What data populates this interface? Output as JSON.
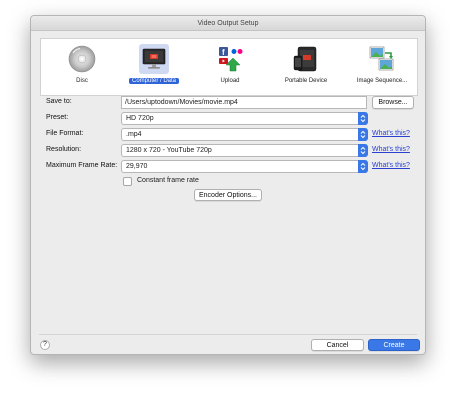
{
  "window": {
    "title": "Video Output Setup"
  },
  "toolbar": {
    "items": [
      {
        "label": "Disc",
        "icon": "disc-icon"
      },
      {
        "label": "Computer / Data",
        "icon": "computer-monitor-icon",
        "selected": true
      },
      {
        "label": "Upload",
        "icon": "upload-icon"
      },
      {
        "label": "Portable Device",
        "icon": "portable-device-icon"
      },
      {
        "label": "Image Sequence...",
        "icon": "image-sequence-icon"
      }
    ]
  },
  "form": {
    "save_to_label": "Save to:",
    "save_to_value": "/Users/uptodown/Movies/movie.mp4",
    "browse_label": "Browse...",
    "preset_label": "Preset:",
    "preset_value": "HD 720p",
    "file_format_label": "File Format:",
    "file_format_value": ".mp4",
    "resolution_label": "Resolution:",
    "resolution_value": "1280 x 720 - YouTube 720p",
    "frame_rate_label": "Maximum Frame Rate:",
    "frame_rate_value": "29,970",
    "whats_this": "What's this?",
    "constant_frame_rate_label": "Constant frame rate",
    "constant_frame_rate_checked": false,
    "encoder_options_label": "Encoder Options..."
  },
  "footer": {
    "help": "?",
    "cancel_label": "Cancel",
    "create_label": "Create"
  },
  "colors": {
    "accent": "#2f63d8",
    "link": "#2b3fd1",
    "window_bg": "#ececec"
  }
}
